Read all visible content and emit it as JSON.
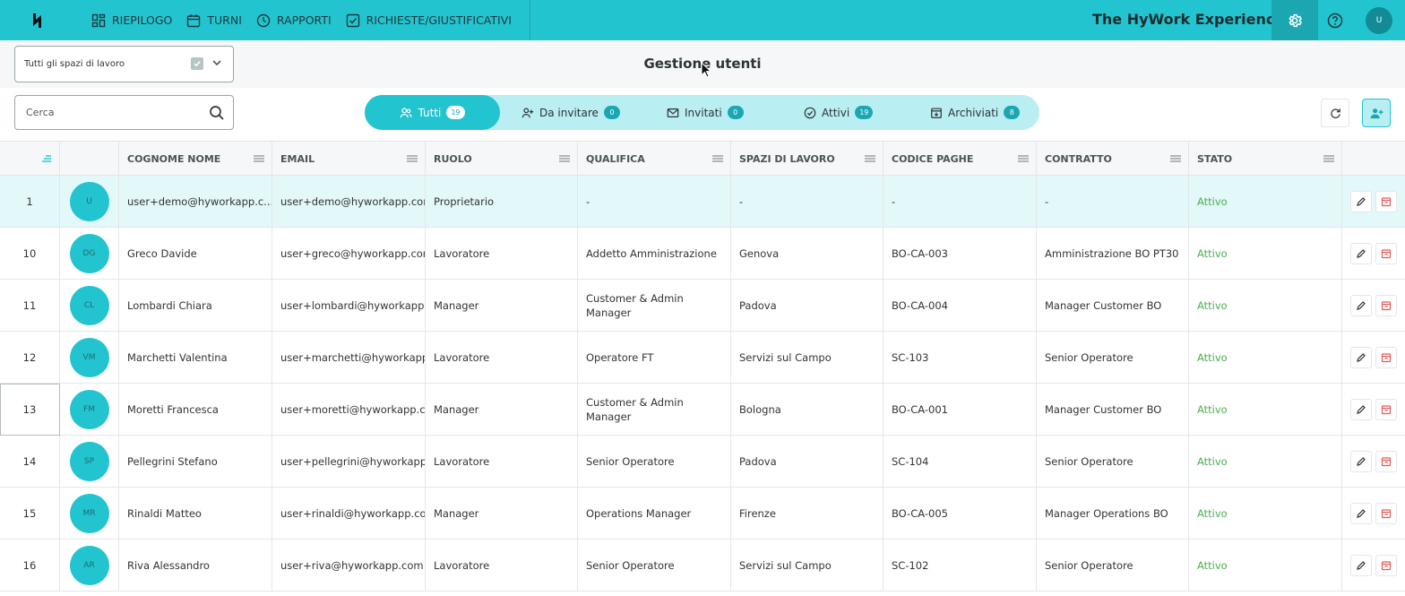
{
  "nav": {
    "items": [
      {
        "label": "RIEPILOGO",
        "icon": "dashboard-icon"
      },
      {
        "label": "TURNI",
        "icon": "calendar-icon"
      },
      {
        "label": "RAPPORTI",
        "icon": "clock-icon"
      },
      {
        "label": "RICHIESTE/GIUSTIFICATIVI",
        "icon": "check-square-icon"
      }
    ],
    "brand": "The HyWork Experience",
    "avatar": "U"
  },
  "subheader": {
    "workspace_select": "Tutti gli spazi di lavoro",
    "title": "Gestione utenti"
  },
  "toolbar": {
    "search_placeholder": "Cerca",
    "tabs": [
      {
        "label": "Tutti",
        "count": "19"
      },
      {
        "label": "Da invitare",
        "count": "0"
      },
      {
        "label": "Invitati",
        "count": "0"
      },
      {
        "label": "Attivi",
        "count": "19"
      },
      {
        "label": "Archiviati",
        "count": "8"
      }
    ]
  },
  "table": {
    "columns": [
      "COGNOME NOME",
      "EMAIL",
      "RUOLO",
      "QUALIFICA",
      "SPAZI DI LAVORO",
      "CODICE PAGHE",
      "CONTRATTO",
      "STATO"
    ],
    "rows": [
      {
        "id": "1",
        "initials": "U",
        "name": "user+demo@hyworkapp.c...",
        "email": "user+demo@hyworkapp.com",
        "role": "Proprietario",
        "qualification": "-",
        "workspace": "-",
        "pay_code": "-",
        "contract": "-",
        "status": "Attivo"
      },
      {
        "id": "10",
        "initials": "DG",
        "name": "Greco Davide",
        "email": "user+greco@hyworkapp.com",
        "role": "Lavoratore",
        "qualification": "Addetto Amministrazione",
        "workspace": "Genova",
        "pay_code": "BO-CA-003",
        "contract": "Amministrazione BO PT30",
        "status": "Attivo"
      },
      {
        "id": "11",
        "initials": "CL",
        "name": "Lombardi Chiara",
        "email": "user+lombardi@hyworkapp.com",
        "role": "Manager",
        "qualification": "Customer & Admin Manager",
        "workspace": "Padova",
        "pay_code": "BO-CA-004",
        "contract": "Manager Customer BO",
        "status": "Attivo"
      },
      {
        "id": "12",
        "initials": "VM",
        "name": "Marchetti Valentina",
        "email": "user+marchetti@hyworkapp.com",
        "role": "Lavoratore",
        "qualification": "Operatore FT",
        "workspace": "Servizi sul Campo",
        "pay_code": "SC-103",
        "contract": "Senior Operatore",
        "status": "Attivo"
      },
      {
        "id": "13",
        "initials": "FM",
        "name": "Moretti Francesca",
        "email": "user+moretti@hyworkapp.com",
        "role": "Manager",
        "qualification": "Customer & Admin Manager",
        "workspace": "Bologna",
        "pay_code": "BO-CA-001",
        "contract": "Manager Customer BO",
        "status": "Attivo"
      },
      {
        "id": "14",
        "initials": "SP",
        "name": "Pellegrini Stefano",
        "email": "user+pellegrini@hyworkapp.com",
        "role": "Lavoratore",
        "qualification": "Senior Operatore",
        "workspace": "Padova",
        "pay_code": "SC-104",
        "contract": "Senior Operatore",
        "status": "Attivo"
      },
      {
        "id": "15",
        "initials": "MR",
        "name": "Rinaldi Matteo",
        "email": "user+rinaldi@hyworkapp.com",
        "role": "Manager",
        "qualification": "Operations Manager",
        "workspace": "Firenze",
        "pay_code": "BO-CA-005",
        "contract": "Manager Operations BO",
        "status": "Attivo"
      },
      {
        "id": "16",
        "initials": "AR",
        "name": "Riva Alessandro",
        "email": "user+riva@hyworkapp.com",
        "role": "Lavoratore",
        "qualification": "Senior Operatore",
        "workspace": "Servizi sul Campo",
        "pay_code": "SC-102",
        "contract": "Senior Operatore",
        "status": "Attivo"
      }
    ]
  },
  "colors": {
    "accent": "#22c4cf",
    "accent_dark": "#1aa7b1",
    "tab_bg": "#b9eef2",
    "status_active": "#4caf50",
    "delete_red": "#e05a5a"
  }
}
